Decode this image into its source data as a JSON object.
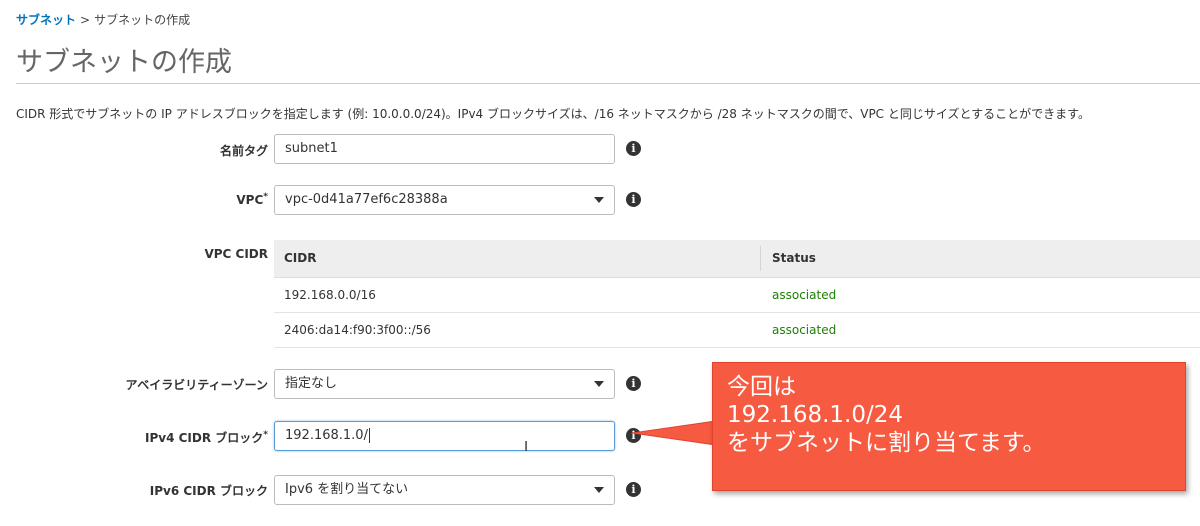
{
  "breadcrumb": {
    "parent": "サブネット",
    "separator": ">",
    "current": "サブネットの作成"
  },
  "page_title": "サブネットの作成",
  "description": "CIDR 形式でサブネットの IP アドレスブロックを指定します (例: 10.0.0.0/24)。IPv4 ブロックサイズは、/16 ネットマスクから /28 ネットマスクの間で、VPC と同じサイズとすることができます。",
  "form": {
    "name_tag": {
      "label": "名前タグ",
      "value": "subnet1"
    },
    "vpc": {
      "label": "VPC",
      "required_mark": "*",
      "value": "vpc-0d41a77ef6c28388a"
    },
    "vpc_cidr": {
      "label": "VPC CIDR",
      "columns": [
        "CIDR",
        "Status"
      ],
      "rows": [
        {
          "cidr": "192.168.0.0/16",
          "status": "associated"
        },
        {
          "cidr": "2406:da14:f90:3f00::/56",
          "status": "associated"
        }
      ]
    },
    "az": {
      "label": "アベイラビリティーゾーン",
      "value": "指定なし"
    },
    "ipv4_cidr": {
      "label": "IPv4 CIDR ブロック",
      "required_mark": "*",
      "value": "192.168.1.0/"
    },
    "ipv6_cidr": {
      "label": "IPv6 CIDR ブロック",
      "value": "Ipv6 を割り当てない"
    }
  },
  "info_glyph": "i",
  "callout": {
    "lines": [
      "今回は",
      "192.168.1.0/24",
      "をサブネットに割り当てます。"
    ]
  },
  "colors": {
    "link": "#0073bb",
    "status_ok": "#1d8102",
    "callout_bg": "#f65a40"
  }
}
